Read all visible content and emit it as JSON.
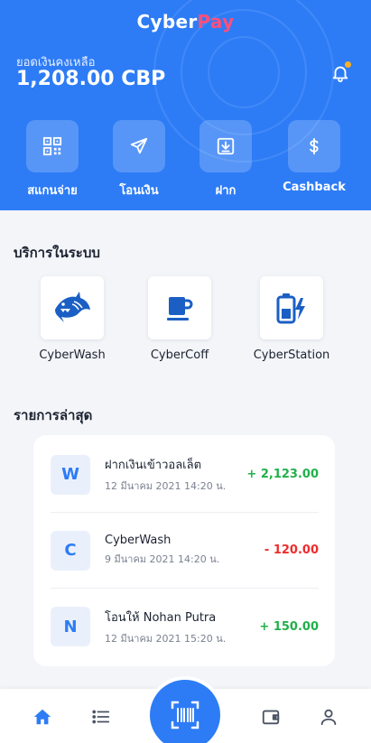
{
  "app": {
    "logo_part1": "Cyber",
    "logo_part2": "Pay"
  },
  "balance": {
    "label": "ยอดเงินคงเหลือ",
    "value": "1,208.00 CBP"
  },
  "colors": {
    "primary": "#2d7cf6",
    "logo_accent": "#ff4f7a",
    "positive": "#21b04b",
    "negative": "#ee2c2c",
    "notification_dot": "#ffb020"
  },
  "notification_icon": "bell-icon",
  "actions": [
    {
      "label": "สแกนจ่าย",
      "icon": "qr-code-icon"
    },
    {
      "label": "โอนเงิน",
      "icon": "send-icon"
    },
    {
      "label": "ฝาก",
      "icon": "deposit-icon"
    },
    {
      "label": "Cashback",
      "icon": "dollar-icon"
    }
  ],
  "services": {
    "title": "บริการในระบบ",
    "items": [
      {
        "label": "CyberWash",
        "icon": "shark-icon"
      },
      {
        "label": "CyberCoff",
        "icon": "coffee-cup-icon"
      },
      {
        "label": "CyberStation",
        "icon": "battery-charging-icon"
      }
    ]
  },
  "transactions": {
    "title": "รายการล่าสุด",
    "items": [
      {
        "initial": "W",
        "name": "ฝากเงินเข้าวอลเล็ต",
        "date": "12 มีนาคม 2021  14:20 น.",
        "amount": "+ 2,123.00",
        "type": "positive"
      },
      {
        "initial": "C",
        "name": "CyberWash",
        "date": "9 มีนาคม 2021  14:20 น.",
        "amount": "- 120.00",
        "type": "negative"
      },
      {
        "initial": "N",
        "name": "โอนให้ Nohan Putra",
        "date": "12 มีนาคม 2021  15:20 น.",
        "amount": "+ 150.00",
        "type": "positive"
      }
    ]
  },
  "bottom_nav": [
    {
      "icon": "home-icon",
      "active": true
    },
    {
      "icon": "list-icon",
      "active": false
    },
    {
      "icon": "barcode-scan-icon",
      "active": false
    },
    {
      "icon": "wallet-icon",
      "active": false
    },
    {
      "icon": "user-icon",
      "active": false
    }
  ]
}
